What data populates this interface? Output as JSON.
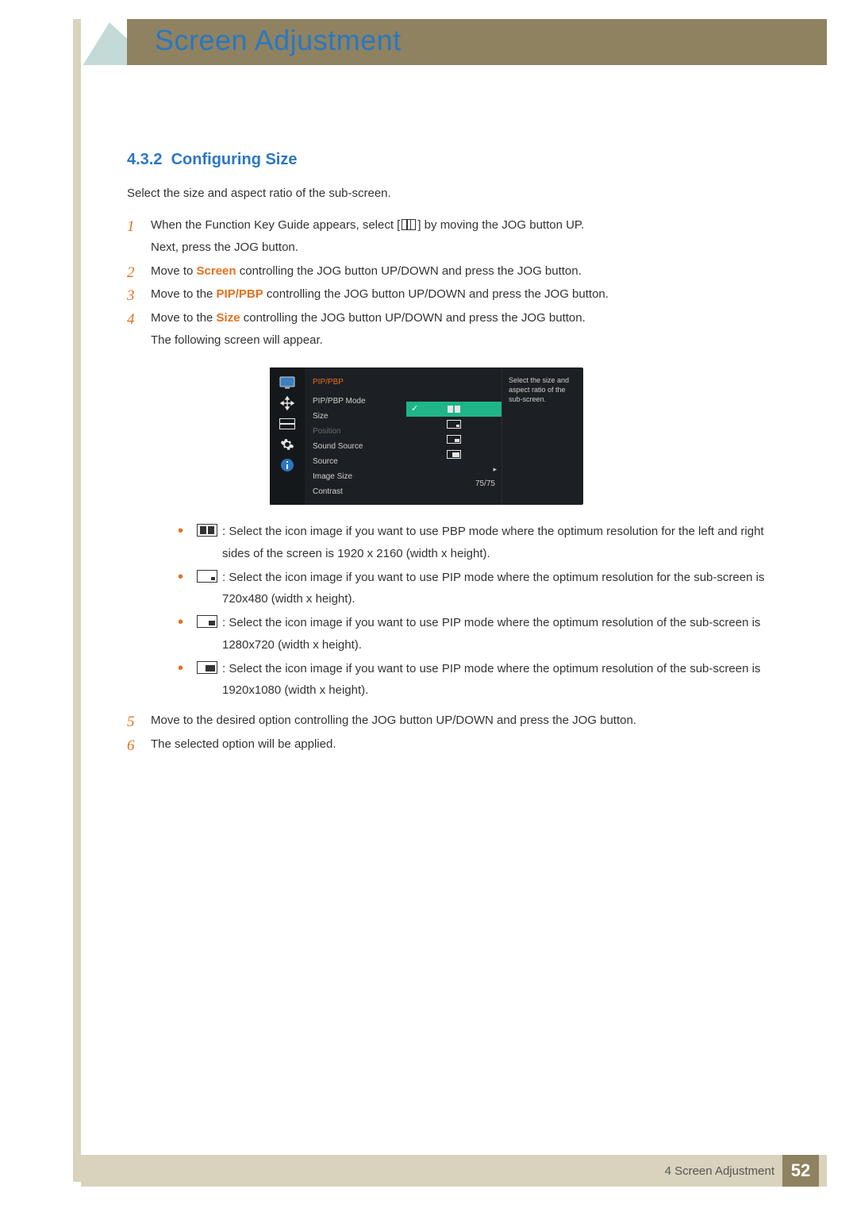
{
  "chapter": {
    "title": "Screen Adjustment",
    "footer_label": "4 Screen Adjustment",
    "page_number": "52"
  },
  "section": {
    "number": "4.3.2",
    "title": "Configuring Size",
    "intro": "Select the size and aspect ratio of the sub-screen."
  },
  "steps": {
    "s1a": "When the Function Key Guide appears, select [",
    "s1b": "] by moving the JOG button UP.",
    "s1c": "Next, press the JOG button.",
    "s2a": "Move to ",
    "s2kw": "Screen",
    "s2b": " controlling the JOG button UP/DOWN and press the JOG button.",
    "s3a": "Move to the ",
    "s3kw": "PIP/PBP",
    "s3b": " controlling the JOG button UP/DOWN and press the JOG button.",
    "s4a": "Move to the ",
    "s4kw": "Size",
    "s4b": " controlling the JOG button UP/DOWN and press the JOG button.",
    "s4c": "The following screen will appear.",
    "s5": "Move to the desired option controlling the JOG button UP/DOWN and press the JOG button.",
    "s6": "The selected option will be applied."
  },
  "osd": {
    "title": "PIP/PBP",
    "rows": {
      "mode": "PIP/PBP Mode",
      "size": "Size",
      "position": "Position",
      "sound": "Sound Source",
      "source": "Source",
      "image_size": "Image Size",
      "contrast": "Contrast"
    },
    "contrast_value": "75/75",
    "aside": "Select the size and aspect ratio of the sub-screen."
  },
  "bullets": {
    "b1": ": Select the icon image if you want to use PBP mode where the optimum resolution for the left and right sides of the screen is 1920 x 2160 (width x height).",
    "b2": ": Select the icon image if you want to use PIP mode where the optimum resolution for the sub-screen is 720x480 (width x height).",
    "b3": ": Select the icon image if you want to use PIP mode where the optimum resolution of the sub-screen is 1280x720 (width x height).",
    "b4": ": Select the icon image if you want to use PIP mode where the optimum resolution of the sub-screen is 1920x1080 (width x height)."
  }
}
